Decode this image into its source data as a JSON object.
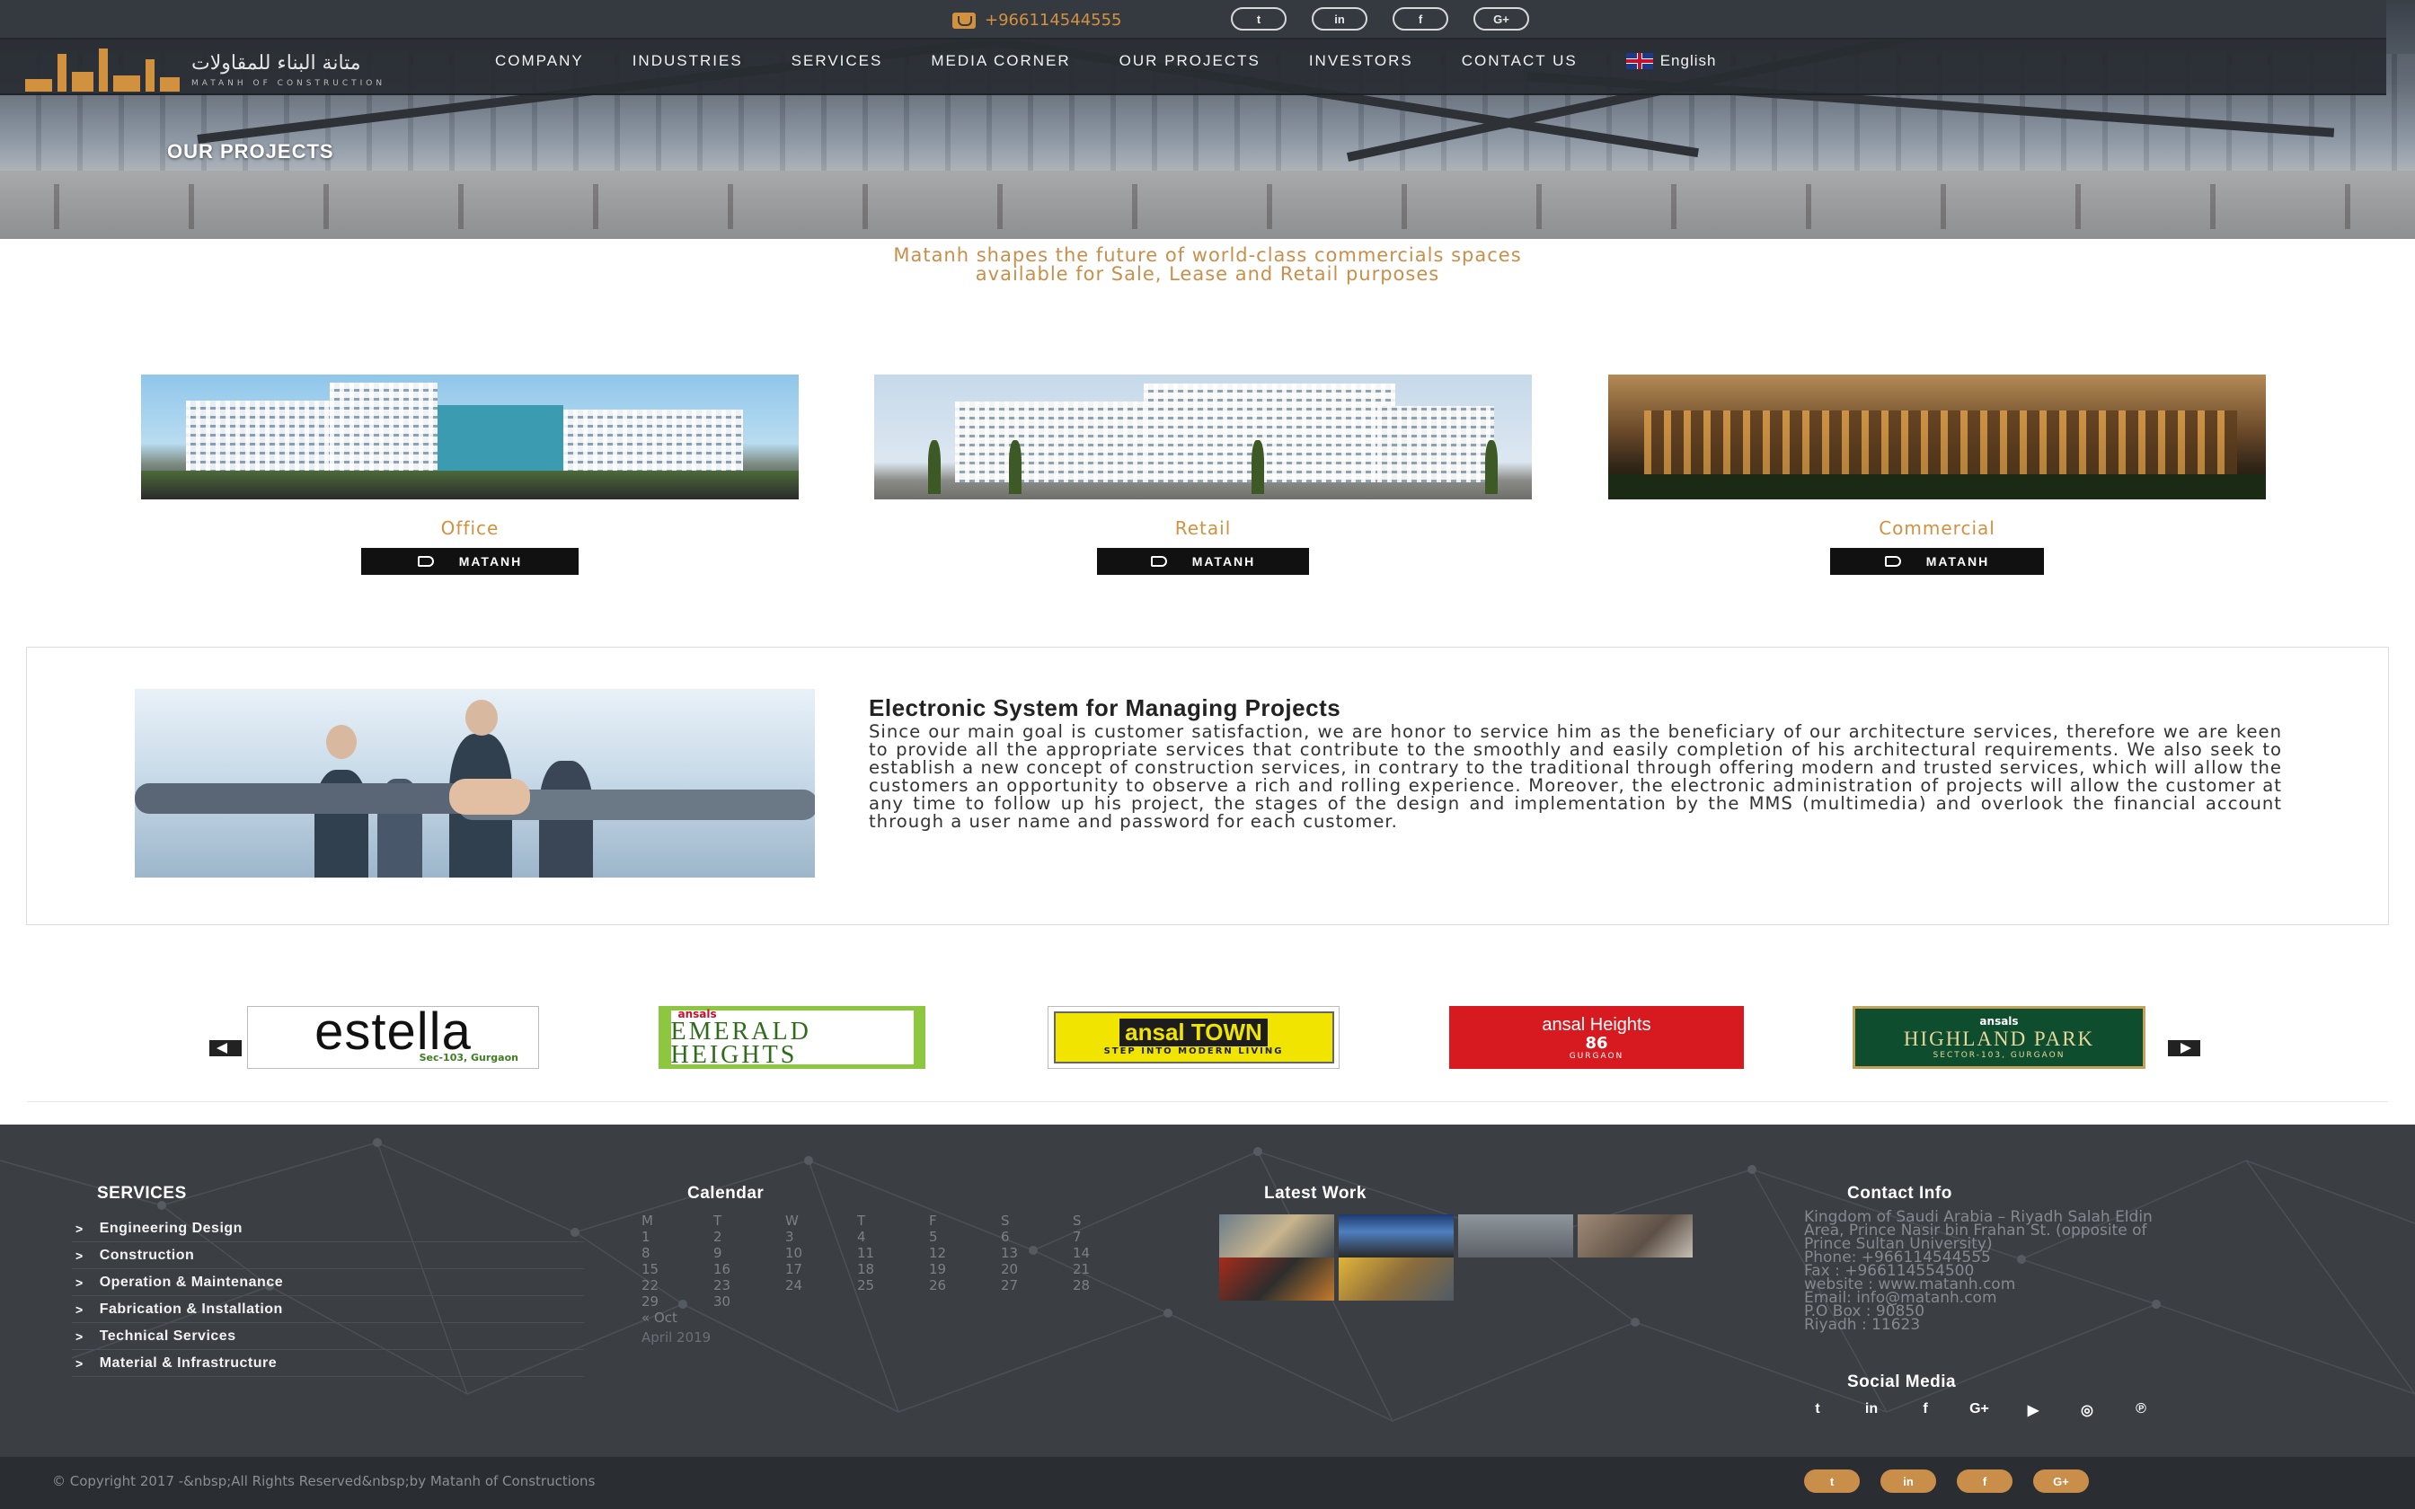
{
  "header": {
    "phone": "+966114544555",
    "social_top": [
      {
        "icon": "twitter-icon",
        "label": "t"
      },
      {
        "icon": "linkedin-icon",
        "label": "in"
      },
      {
        "icon": "facebook-icon",
        "label": "f"
      },
      {
        "icon": "google-plus-icon",
        "label": "G+"
      }
    ],
    "logo": {
      "arabic": "متانة البناء للمقاولات",
      "english": "MATANH OF CONSTRUCTION"
    },
    "nav": [
      "COMPANY",
      "INDUSTRIES",
      "SERVICES",
      "MEDIA CORNER",
      "OUR PROJECTS",
      "INVESTORS",
      "CONTACT US"
    ],
    "language": "English",
    "hero_title": "OUR PROJECTS"
  },
  "intro": {
    "line1": "Matanh shapes the future of world-class commercials spaces",
    "line2": "available for Sale, Lease and Retail purposes"
  },
  "categories": [
    {
      "caption": "Office",
      "button": "MATANH"
    },
    {
      "caption": "Retail",
      "button": "MATANH"
    },
    {
      "caption": "Commercial",
      "button": "MATANH"
    }
  ],
  "esystem": {
    "title": "Electronic System for Managing Projects",
    "body": "Since our main goal is customer satisfaction, we are honor to service him as the beneficiary of our architecture services, therefore we are keen to provide all the appropriate services that contribute to the smoothly and easily completion of his architectural requirements. We also seek to establish a new concept of construction services, in contrary to the traditional through offering modern and trusted services, which will allow the customers an opportunity to observe a rich and rolling experience. Moreover, the electronic administration of projects will allow the customer at any time to follow up his project, the stages of the design and implementation by the MMS (multimedia) and overlook the financial account through a user name and password for each customer."
  },
  "brands": [
    {
      "main": "estella",
      "sub": "Sec-103, Gurgaon"
    },
    {
      "top": "ansals",
      "main": "EMERALD HEIGHTS"
    },
    {
      "main": "ansal TOWN",
      "sub": "STEP INTO MODERN LIVING"
    },
    {
      "main": "ansal Heights",
      "num": "86",
      "sub": "GURGAON"
    },
    {
      "top": "ansals",
      "main": "HIGHLAND PARK",
      "sub": "SECTOR-103, GURGAON"
    }
  ],
  "footer": {
    "services_title": "SERVICES",
    "services": [
      "Engineering Design",
      "Construction",
      "Operation & Maintenance",
      "Fabrication & Installation",
      "Technical Services",
      "Material & Infrastructure"
    ],
    "calendar_title": "Calendar",
    "calendar_head": [
      "M",
      "T",
      "W",
      "T",
      "F",
      "S",
      "S"
    ],
    "calendar_rows": [
      [
        "1",
        "2",
        "3",
        "4",
        "5",
        "6",
        "7"
      ],
      [
        "8",
        "9",
        "10",
        "11",
        "12",
        "13",
        "14"
      ],
      [
        "15",
        "16",
        "17",
        "18",
        "19",
        "20",
        "21"
      ],
      [
        "22",
        "23",
        "24",
        "25",
        "26",
        "27",
        "28"
      ],
      [
        "29",
        "30",
        "",
        "",
        "",
        "",
        ""
      ]
    ],
    "calendar_prev": "« Oct",
    "calendar_month": "April 2019",
    "latest_title": "Latest Work",
    "contact_title": "Contact Info",
    "contact_lines": [
      "Kingdom of Saudi Arabia – Riyadh Salah Eldin",
      "Area, Prince Nasir bin Frahan St. (opposite of",
      "Prince Sultan University)",
      "Phone: +966114544555",
      "Fax : +966114554500",
      "website : www.matanh.com",
      "Email: info@matanh.com",
      "P.O Box : 90850",
      "Riyadh : 11623"
    ],
    "social_title": "Social Media",
    "social": [
      {
        "icon": "twitter-icon",
        "label": "t"
      },
      {
        "icon": "linkedin-icon",
        "label": "in"
      },
      {
        "icon": "facebook-icon",
        "label": "f"
      },
      {
        "icon": "google-plus-icon",
        "label": "G+"
      },
      {
        "icon": "youtube-icon",
        "label": "▶"
      },
      {
        "icon": "instagram-icon",
        "label": "◎"
      },
      {
        "icon": "pinterest-icon",
        "label": "℗"
      }
    ],
    "copyright": "© Copyright 2017 -&nbsp;All Rights Reserved&nbsp;by Matanh of Constructions",
    "bottom_social": [
      {
        "icon": "twitter-icon",
        "label": "t"
      },
      {
        "icon": "linkedin-icon",
        "label": "in"
      },
      {
        "icon": "facebook-icon",
        "label": "f"
      },
      {
        "icon": "google-plus-icon",
        "label": "G+"
      }
    ]
  },
  "colors": {
    "accent": "#d2913f",
    "footer_bg": "#3b3f44",
    "button_bg": "#111111"
  }
}
